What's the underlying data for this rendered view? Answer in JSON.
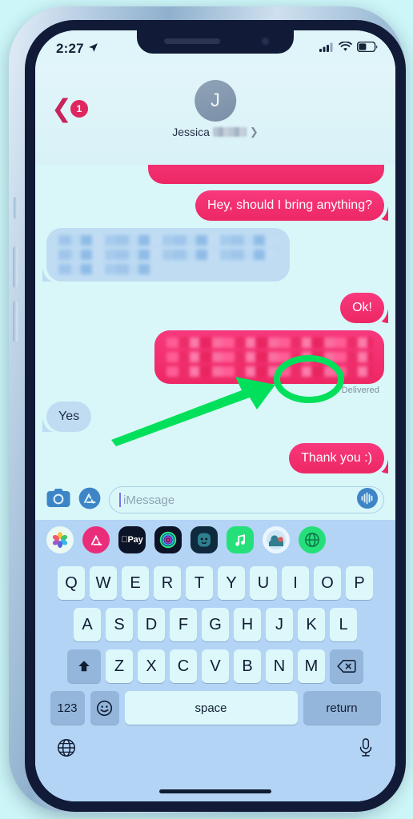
{
  "device": {
    "frame_color": "#b9cfe4",
    "bezel_color": "#111a36",
    "backdrop_color": "#ccf5f7"
  },
  "status_bar": {
    "time": "2:27",
    "location_icon": "location-arrow-icon",
    "cellular_icon": "cellular-bars-icon",
    "wifi_icon": "wifi-icon",
    "battery_icon": "battery-icon",
    "battery_level_pct": 42
  },
  "nav": {
    "back_icon": "chevron-left-icon",
    "unread_badge": "1",
    "badge_color": "#e0255f",
    "avatar_initial": "J",
    "contact_name": "Jessica",
    "contact_name_redacted": true,
    "detail_chevron_icon": "chevron-right-icon"
  },
  "conversation": {
    "background_color": "#d9f7f9",
    "sent_bubble_color": "#ed2764",
    "received_bubble_color": "#bfdcf3",
    "messages": [
      {
        "id": "m0",
        "side": "out",
        "text": "",
        "redacted": true,
        "clipped": true,
        "lines": 1,
        "width_pct": 70
      },
      {
        "id": "m1",
        "side": "out",
        "text": "Hey, should I bring anything?",
        "redacted": false
      },
      {
        "id": "m2",
        "side": "in",
        "text": "",
        "redacted": true,
        "lines": 3,
        "width_pct": 72
      },
      {
        "id": "m3",
        "side": "out",
        "text": "Ok!",
        "redacted": false
      },
      {
        "id": "m4",
        "side": "out",
        "text": "",
        "redacted": true,
        "lines": 3,
        "width_pct": 68
      },
      {
        "id": "m5",
        "side": "in",
        "text": "Yes",
        "redacted": false
      },
      {
        "id": "m6",
        "side": "out",
        "text": "Thank you :)",
        "redacted": false
      }
    ],
    "delivered_label": "Delivered",
    "delivered_label_color": "#7e8d9d"
  },
  "annotation": {
    "highlight_color": "#00e05a",
    "circle_target": "Delivered",
    "arrow_points_to": "Delivered"
  },
  "input_bar": {
    "camera_icon": "camera-icon",
    "appstore_icon": "app-store-icon",
    "placeholder": "iMessage",
    "value": "",
    "audio_icon": "audio-waveform-icon"
  },
  "app_strip": {
    "apps": [
      {
        "name": "photos-app-icon",
        "label": "Photos"
      },
      {
        "name": "app-store-app-icon",
        "label": "App Store"
      },
      {
        "name": "apple-pay-app-icon",
        "label": "Apple Pay"
      },
      {
        "name": "digital-touch-app-icon",
        "label": "Digital Touch"
      },
      {
        "name": "memoji-app-icon",
        "label": "Memoji"
      },
      {
        "name": "music-app-icon",
        "label": "Music"
      },
      {
        "name": "memoji-stickers-app-icon",
        "label": "Memoji Stickers"
      },
      {
        "name": "globe-app-icon",
        "label": "Globe"
      }
    ]
  },
  "keyboard": {
    "row1": [
      "Q",
      "W",
      "E",
      "R",
      "T",
      "Y",
      "U",
      "I",
      "O",
      "P"
    ],
    "row2": [
      "A",
      "S",
      "D",
      "F",
      "G",
      "H",
      "J",
      "K",
      "L"
    ],
    "row3": [
      "Z",
      "X",
      "C",
      "V",
      "B",
      "N",
      "M"
    ],
    "shift_icon": "shift-arrow-icon",
    "backspace_icon": "backspace-icon",
    "numbers_key": "123",
    "emoji_icon": "emoji-smiley-icon",
    "space_key": "space",
    "return_key": "return",
    "globe_icon": "globe-icon",
    "mic_icon": "microphone-icon"
  }
}
